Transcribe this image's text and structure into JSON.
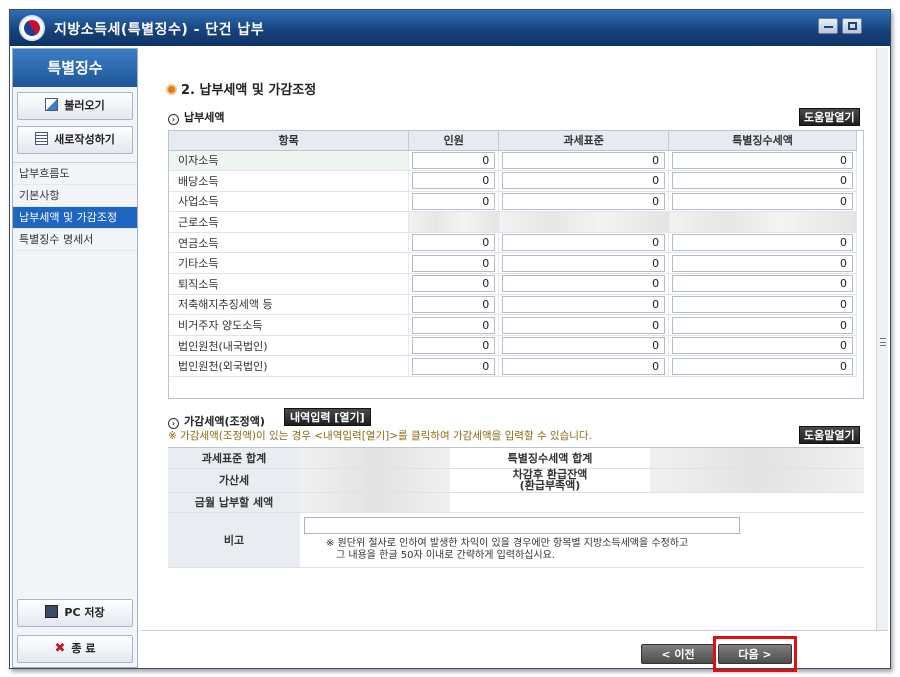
{
  "window": {
    "title": "지방소득세(특별징수) - 단건 납부",
    "minimize_icon": "minimize-icon",
    "maximize_icon": "restore-icon"
  },
  "sidebar": {
    "header": "특별징수",
    "load_button": "불러오기",
    "new_button": "새로작성하기",
    "nav": [
      {
        "label": "납부흐름도",
        "active": false
      },
      {
        "label": "기본사항",
        "active": false
      },
      {
        "label": "납부세액 및 가감조정",
        "active": true
      },
      {
        "label": "특별징수 명세서",
        "active": false
      }
    ],
    "save_button": "PC 저장",
    "exit_button": "종 료"
  },
  "main": {
    "section_title": "2. 납부세액 및 가감조정",
    "payment": {
      "subtitle": "납부세액",
      "help_button": "도움말열기",
      "columns": [
        "항목",
        "인원",
        "과세표준",
        "특별징수세액"
      ],
      "rows": [
        {
          "label": "이자소득",
          "count": "0",
          "base": "0",
          "tax": "0"
        },
        {
          "label": "배당소득",
          "count": "0",
          "base": "0",
          "tax": "0"
        },
        {
          "label": "사업소득",
          "count": "0",
          "base": "0",
          "tax": "0"
        },
        {
          "label": "근로소득",
          "count": "",
          "base": "",
          "tax": "",
          "blurred": true
        },
        {
          "label": "연금소득",
          "count": "0",
          "base": "0",
          "tax": "0"
        },
        {
          "label": "기타소득",
          "count": "0",
          "base": "0",
          "tax": "0"
        },
        {
          "label": "퇴직소득",
          "count": "0",
          "base": "0",
          "tax": "0"
        },
        {
          "label": "저축해지추징세액 등",
          "count": "0",
          "base": "0",
          "tax": "0"
        },
        {
          "label": "비거주자 양도소득",
          "count": "0",
          "base": "0",
          "tax": "0"
        },
        {
          "label": "법인원천(내국법인)",
          "count": "0",
          "base": "0",
          "tax": "0"
        },
        {
          "label": "법인원천(외국법인)",
          "count": "0",
          "base": "0",
          "tax": "0"
        }
      ]
    },
    "adjust": {
      "subtitle": "가감세액(조정액)",
      "detail_button": "내역입력 [열기]",
      "note": "※ 가감세액(조정액)이 있는 경우 <내역입력[열기]>를 클릭하여 가감세액을 입력할 수 있습니다.",
      "help_button": "도움말열기",
      "labels": {
        "tax_base_total": "과세표준 합계",
        "special_tax_total": "특별징수세액 합계",
        "additional_tax": "가산세",
        "refund_balance": "차감후 환급잔액\n(환급부족액)",
        "monthly_payment": "금월 납부할 세액",
        "remarks": "비고"
      },
      "remarks_note_line1": "※ 원단위 절사로 인하여 발생한 차익이 있을 경우에만 항목별 지방소득세액을 수정하고",
      "remarks_note_line2": "그 내용을 한글 50자 이내로 간략하게 입력하십시요."
    }
  },
  "footer": {
    "prev_button": "< 이전",
    "next_button": "다음 >",
    "highlight_color": "#e01010"
  }
}
